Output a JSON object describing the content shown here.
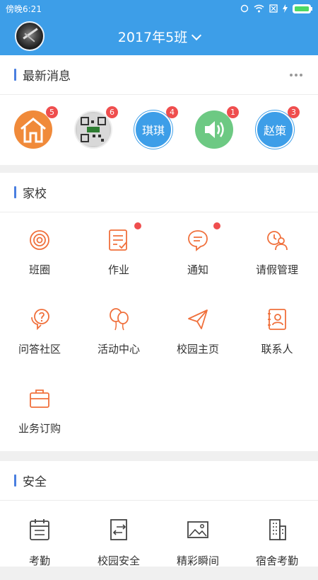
{
  "status": {
    "time": "傍晚6:21",
    "icons": [
      "alarm-icon",
      "wifi-icon",
      "sim-icon",
      "charging-icon",
      "battery-icon"
    ]
  },
  "header": {
    "title": "2017年5班",
    "avatar": "user-avatar"
  },
  "news": {
    "title": "最新消息",
    "items": [
      {
        "type": "icon",
        "icon": "house-icon",
        "color": "#f08a3a",
        "badge": "5"
      },
      {
        "type": "image",
        "icon": "qrcode-avatar",
        "badge": "6"
      },
      {
        "type": "text",
        "label": "琪琪",
        "color": "#3d9ee8",
        "badge": "4"
      },
      {
        "type": "icon",
        "icon": "speaker-icon",
        "color": "#6dc983",
        "badge": "1"
      },
      {
        "type": "text",
        "label": "赵策",
        "color": "#3d9ee8",
        "badge": "3"
      }
    ]
  },
  "home_school": {
    "title": "家校",
    "items": [
      {
        "label": "班圈",
        "icon": "circle-icon",
        "dot": false
      },
      {
        "label": "作业",
        "icon": "homework-icon",
        "dot": true
      },
      {
        "label": "通知",
        "icon": "notice-icon",
        "dot": true
      },
      {
        "label": "请假管理",
        "icon": "leave-icon",
        "dot": false
      },
      {
        "label": "问答社区",
        "icon": "qa-icon",
        "dot": false
      },
      {
        "label": "活动中心",
        "icon": "balloon-icon",
        "dot": false
      },
      {
        "label": "校园主页",
        "icon": "paper-plane-icon",
        "dot": false
      },
      {
        "label": "联系人",
        "icon": "contacts-icon",
        "dot": false
      },
      {
        "label": "业务订购",
        "icon": "briefcase-icon",
        "dot": false
      }
    ]
  },
  "safety": {
    "title": "安全",
    "items": [
      {
        "label": "考勤",
        "icon": "calendar-icon"
      },
      {
        "label": "校园安全",
        "icon": "gate-icon"
      },
      {
        "label": "精彩瞬间",
        "icon": "picture-icon"
      },
      {
        "label": "宿舍考勤",
        "icon": "building-icon"
      }
    ]
  },
  "colors": {
    "primary": "#3d9ee8",
    "accent_orange": "#f0703c",
    "badge_red": "#ef4e4e",
    "section_bar": "#4a7fe0"
  }
}
